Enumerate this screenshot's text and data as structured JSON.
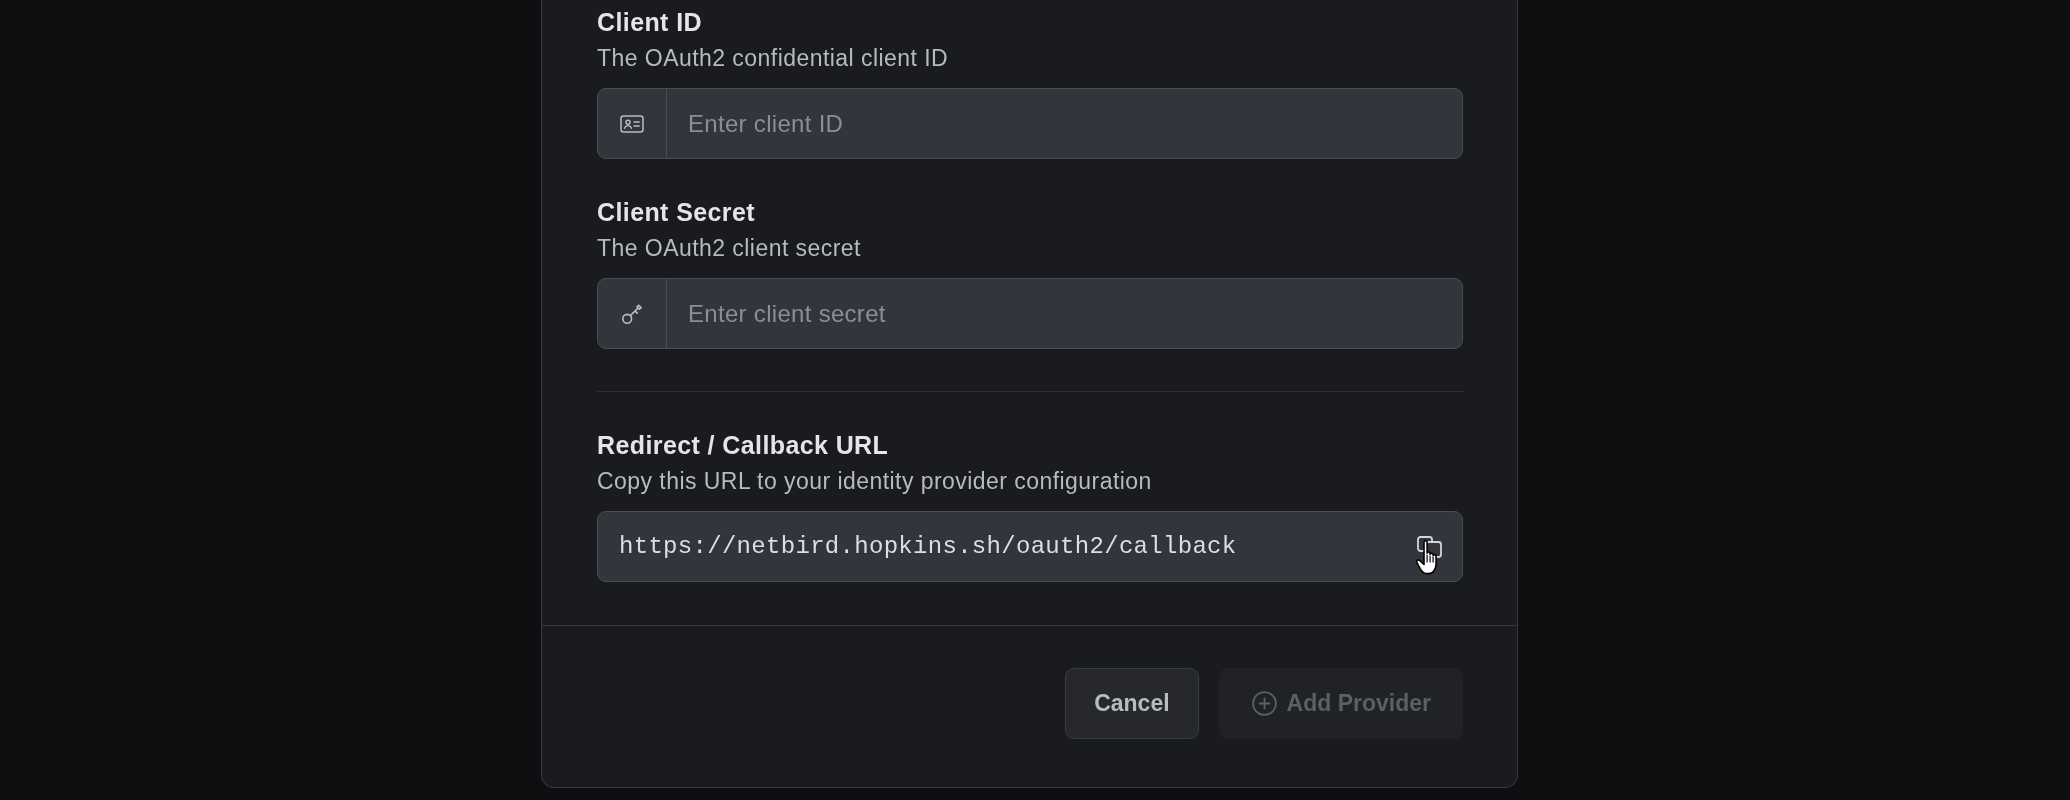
{
  "fields": [
    {
      "kind": "input",
      "label": "Client ID",
      "description": "The OAuth2 confidential client ID",
      "placeholder": "Enter client ID"
    },
    {
      "kind": "input",
      "label": "Client Secret",
      "description": "The OAuth2 client secret",
      "placeholder": "Enter client secret"
    }
  ],
  "redirect": {
    "label": "Redirect / Callback URL",
    "description": "Copy this URL to your identity provider configuration",
    "value": "https://netbird.hopkins.sh/oauth2/callback"
  },
  "buttons": [
    {
      "kind": "secondary",
      "label": "Cancel",
      "disabled": false
    },
    {
      "kind": "primary",
      "label": "Add Provider",
      "disabled": true
    }
  ]
}
